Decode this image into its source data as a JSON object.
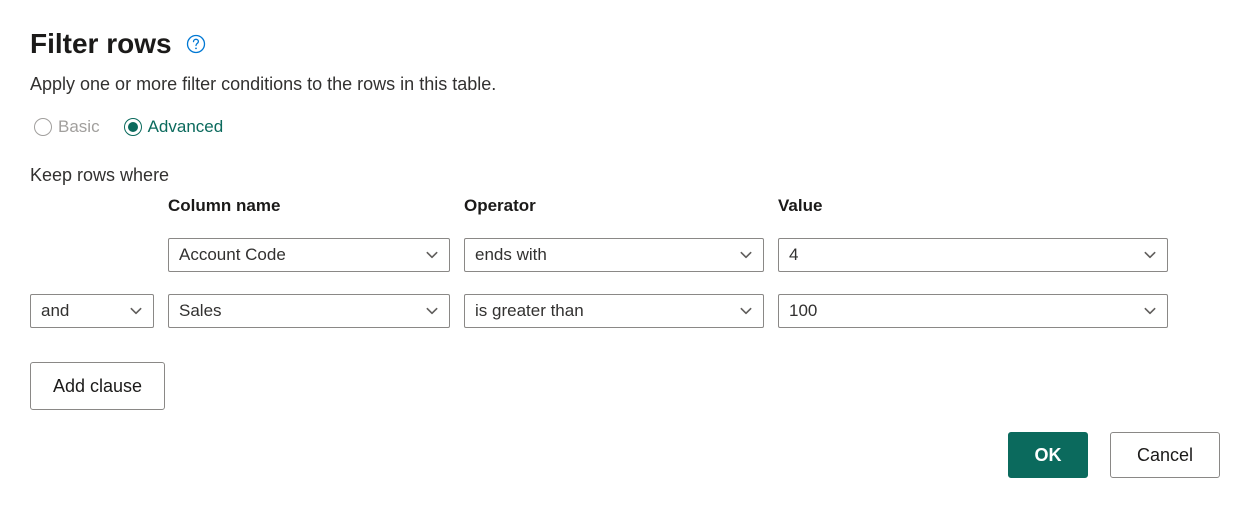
{
  "dialog": {
    "title": "Filter rows",
    "subtitle": "Apply one or more filter conditions to the rows in this table.",
    "mode": {
      "basic_label": "Basic",
      "advanced_label": "Advanced",
      "selected": "advanced"
    },
    "keep_rows_label": "Keep rows where",
    "headers": {
      "column": "Column name",
      "operator": "Operator",
      "value": "Value"
    },
    "clauses": [
      {
        "conjunction": null,
        "column": "Account Code",
        "operator": "ends with",
        "value": "4"
      },
      {
        "conjunction": "and",
        "column": "Sales",
        "operator": "is greater than",
        "value": "100"
      }
    ],
    "add_clause_label": "Add clause",
    "ok_label": "OK",
    "cancel_label": "Cancel"
  },
  "colors": {
    "accent": "#0b6a5d",
    "link": "#0078d4"
  }
}
